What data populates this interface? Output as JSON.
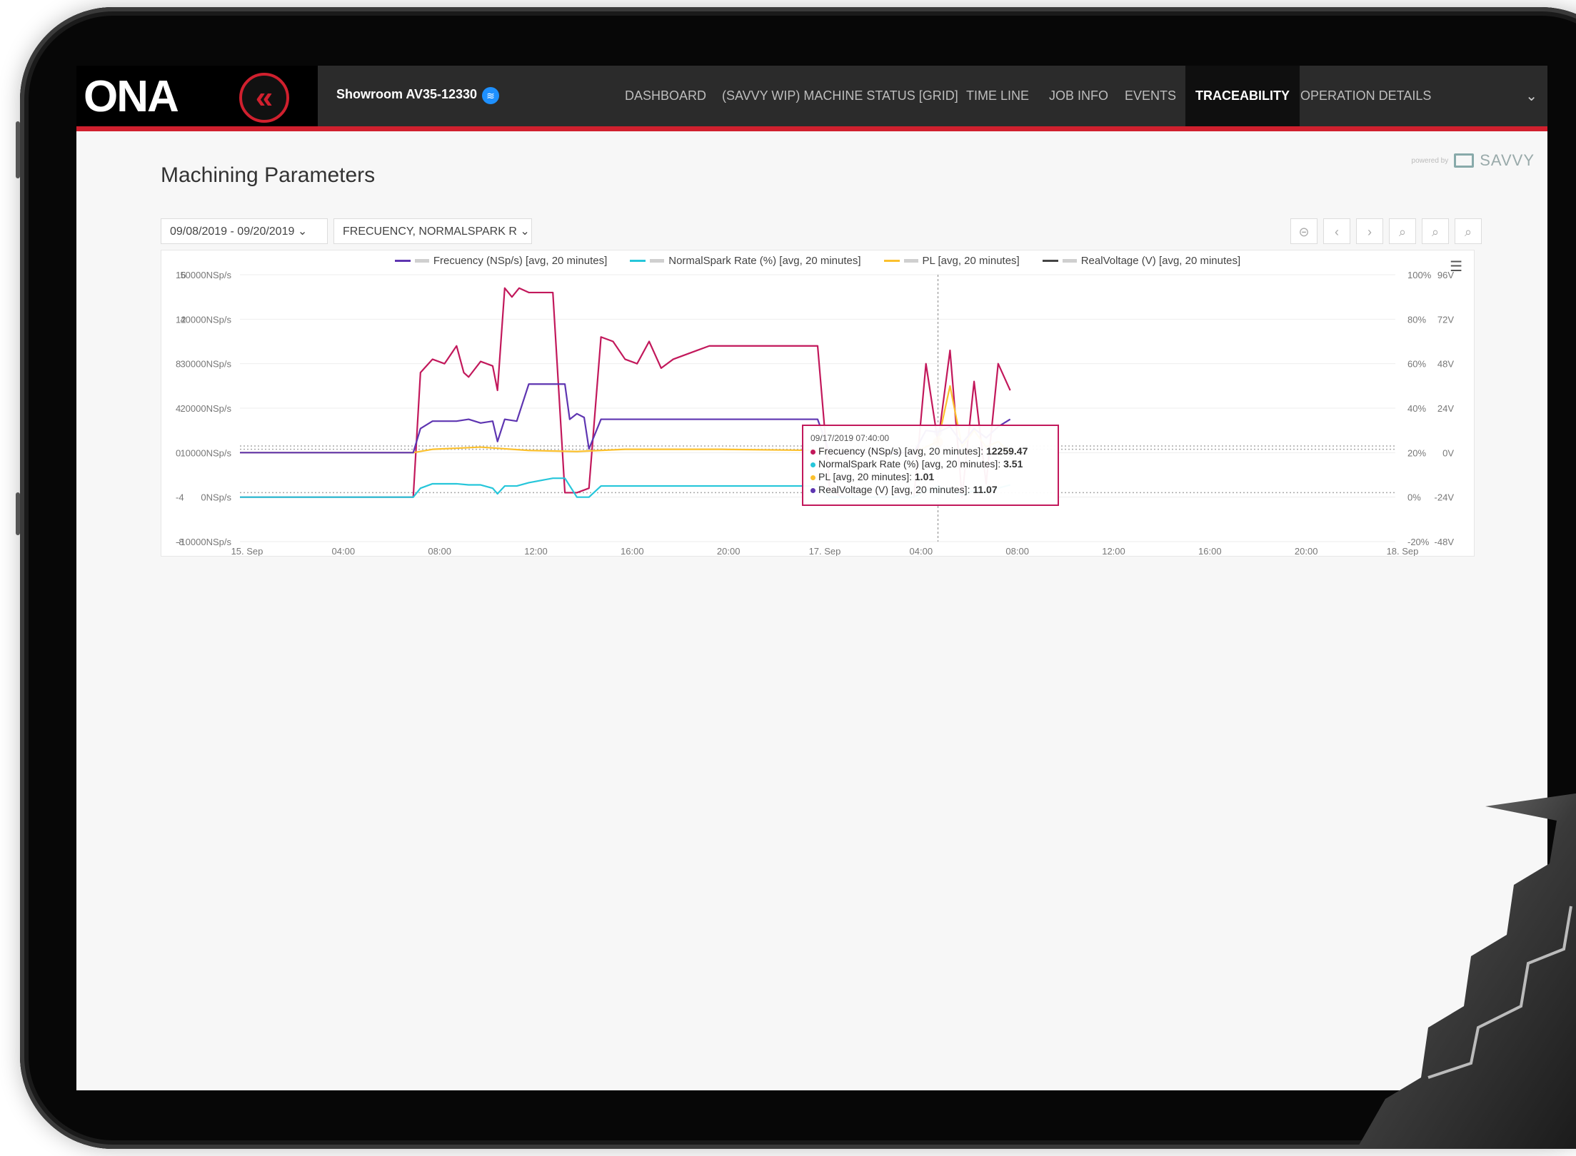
{
  "header": {
    "logo": "ONA",
    "machine_name": "Showroom AV35-12330",
    "nav_tabs": [
      "DASHBOARD",
      "(SAVVY WIP) MACHINE STATUS [GRID]",
      "TIME LINE",
      "JOB INFO",
      "EVENTS",
      "TRACEABILITY",
      "OPERATION DETAILS"
    ],
    "active_tab": "TRACEABILITY"
  },
  "page": {
    "title": "Machining Parameters",
    "powered_by": "powered by",
    "brand": "SAVVY"
  },
  "filters": {
    "date_range": "09/08/2019 - 09/20/2019",
    "parameters": "FRECUENCY, NORMALSPARK R"
  },
  "colors": {
    "frequency": "#c2185b",
    "normalspark": "#26c6da",
    "pl": "#fbc02d",
    "realvoltage": "#5e35b1",
    "accent": "#d0202e"
  },
  "chart_data": {
    "type": "line",
    "legend_placement": "top-center",
    "grid": true,
    "x_axis": {
      "tick_labels": [
        "15. Sep",
        "04:00",
        "08:00",
        "12:00",
        "16:00",
        "20:00",
        "17. Sep",
        "04:00",
        "08:00",
        "12:00",
        "16:00",
        "20:00",
        "18. Sep"
      ]
    },
    "y_axes": [
      {
        "tick_labels": [
          "-8",
          "-4",
          "0",
          "4",
          "8",
          "12",
          "16"
        ],
        "range": [
          -8,
          16
        ]
      },
      {
        "tick_labels": [
          "-10000NSp/s",
          "0NSp/s",
          "10000NSp/s",
          "20000NSp/s",
          "30000NSp/s",
          "40000NSp/s",
          "50000NSp/s"
        ],
        "range": [
          -10000,
          50000
        ]
      },
      {
        "tick_labels": [
          "-20%",
          "0%",
          "20%",
          "40%",
          "60%",
          "80%",
          "100%"
        ],
        "range": [
          -20,
          100
        ]
      },
      {
        "tick_labels": [
          "-48V",
          "-24V",
          "0V",
          "24V",
          "48V",
          "72V",
          "96V"
        ],
        "range": [
          -48,
          96
        ]
      }
    ],
    "series": [
      {
        "name": "Frecuency (NSp/s) [avg, 20 minutes]",
        "unit_axis": "NSp/s",
        "x": [
          0,
          4,
          7.2,
          7.5,
          8,
          8.5,
          9,
          9.3,
          9.5,
          10,
          10.5,
          10.7,
          11,
          11.3,
          11.6,
          12,
          12.5,
          13,
          13.5,
          14,
          14.5,
          15,
          15.5,
          16,
          16.5,
          17,
          17.5,
          18,
          18.5,
          19,
          19.5,
          20,
          21,
          22,
          23,
          24,
          24.5,
          25,
          26,
          27,
          28,
          28.5,
          29,
          29.5,
          30,
          30.5,
          31,
          31.5,
          32
        ],
        "y": [
          0,
          0,
          0,
          28000,
          31000,
          30000,
          34000,
          28000,
          27000,
          30500,
          29500,
          24000,
          47000,
          45000,
          47000,
          46000,
          46000,
          46000,
          1000,
          1000,
          2000,
          36000,
          35000,
          31000,
          30000,
          35000,
          29000,
          31000,
          32000,
          33000,
          34000,
          34000,
          34000,
          34000,
          34000,
          34000,
          2000,
          0,
          0,
          0,
          0,
          30000,
          12259,
          33000,
          0,
          26000,
          3000,
          30000,
          24000
        ]
      },
      {
        "name": "NormalSpark Rate (%) [avg, 20 minutes]",
        "unit_axis": "%",
        "x": [
          0,
          4,
          7.2,
          7.5,
          8,
          9,
          9.5,
          10,
          10.5,
          10.7,
          11,
          11.5,
          12,
          13,
          13.5,
          14,
          14.5,
          15,
          16,
          20,
          22,
          24,
          24.5,
          25,
          28,
          28.5,
          29,
          29.5,
          30,
          30.5,
          31,
          31.5,
          32
        ],
        "y": [
          0,
          0,
          0,
          4,
          6,
          6,
          5.5,
          5.5,
          4,
          1.5,
          5,
          5,
          6.5,
          8.5,
          8.5,
          0,
          0,
          5,
          5,
          5,
          5,
          5,
          0,
          0,
          0,
          3,
          3.51,
          4,
          1,
          3,
          2,
          4,
          5.5
        ]
      },
      {
        "name": "PL [avg, 20 minutes]",
        "unit_axis": "",
        "x": [
          0,
          4,
          7.2,
          8,
          10,
          12,
          14,
          16,
          20,
          24,
          24.5,
          25,
          28,
          28.5,
          29,
          29.5,
          30,
          30.5,
          31,
          31.5,
          32
        ],
        "y": [
          0,
          0,
          0,
          0.3,
          0.5,
          0.2,
          0.1,
          0.3,
          0.3,
          0.2,
          0,
          0,
          0,
          0.5,
          1.01,
          6,
          0.5,
          2,
          0.5,
          1,
          0
        ]
      },
      {
        "name": "RealVoltage (V) [avg, 20 minutes]",
        "unit_axis": "V",
        "x": [
          0,
          4,
          7.2,
          7.5,
          8,
          9,
          9.5,
          10,
          10.5,
          10.7,
          11,
          11.5,
          12,
          13,
          13.5,
          13.7,
          14,
          14.3,
          14.5,
          15,
          16,
          20,
          22,
          24,
          24.5,
          25,
          28,
          28.5,
          29,
          29.5,
          30,
          30.5,
          31,
          31.5,
          32
        ],
        "y": [
          0,
          0,
          0,
          13,
          17,
          17,
          18,
          16,
          17,
          6,
          18,
          17,
          37,
          37,
          37,
          18,
          21,
          19,
          2,
          18,
          18,
          18,
          18,
          18,
          0,
          0,
          0,
          12,
          11.07,
          14,
          5,
          13,
          8,
          14,
          18
        ]
      }
    ],
    "threshold_lines": [
      0.6,
      0.3,
      -3.6
    ],
    "tooltip": {
      "timestamp": "09/17/2019 07:40:00",
      "rows": [
        {
          "label": "Frecuency (NSp/s) [avg, 20 minutes]",
          "value": "12259.47"
        },
        {
          "label": "NormalSpark Rate (%) [avg, 20 minutes]",
          "value": "3.51"
        },
        {
          "label": "PL [avg, 20 minutes]",
          "value": "1.01"
        },
        {
          "label": "RealVoltage (V) [avg, 20 minutes]",
          "value": "11.07"
        }
      ]
    }
  }
}
